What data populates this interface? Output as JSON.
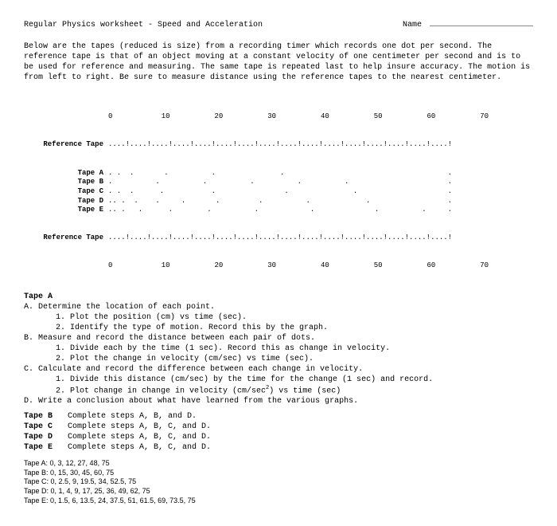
{
  "header": {
    "title": "Regular Physics worksheet - Speed and Acceleration",
    "name_label": "Name"
  },
  "intro": "Below are the tapes (reduced is size) from a recording timer which records one dot per second. The reference tape is that of an object moving at a constant velocity of one centimeter per second and is to be used for reference and measuring. The same tape is repeated last to help insure accuracy. The motion is from left to right. Be sure to measure distance using the reference tapes to the nearest centimeter.",
  "scale": [
    "0",
    "10",
    "20",
    "30",
    "40",
    "50",
    "60",
    "70"
  ],
  "tapes": {
    "ref_label": "Reference Tape",
    "ref_pattern": "....!....!....!....!....!....!....!....!....!....!....!....!....!....!....!....!",
    "rows": [
      {
        "label": "Tape A",
        "pattern": ". .  .       .          .               .                                      ."
      },
      {
        "label": "Tape B",
        "pattern": ".          .          .          .          .          .                       ."
      },
      {
        "label": "Tape C",
        "pattern": ". .  .      .           .                .               .                     ."
      },
      {
        "label": "Tape D",
        "pattern": ".. .  .    .     .       .         .          .             .                  ."
      },
      {
        "label": "Tape E",
        "pattern": ".. .   .      .        .          .            .              .          .     ."
      }
    ]
  },
  "taskHeader": "Tape A",
  "tasks": [
    {
      "letter": "A",
      "text": "Determine the location of each point.",
      "subs": [
        "1. Plot the position (cm) vs time (sec).",
        "2. Identify the type of motion. Record this by the graph."
      ]
    },
    {
      "letter": "B",
      "text": "Measure and record the distance between each pair of dots.",
      "subs": [
        "1. Divide each by the time (1 sec). Record this as change in velocity.",
        "2. Plot the change in velocity (cm/sec) vs time (sec)."
      ]
    },
    {
      "letter": "C",
      "text": "Calculate and record the difference between each change in velocity.",
      "subs": [
        "1. Divide this distance (cm/sec) by the time for the change (1 sec) and record.",
        "2. Plot change in change in velocity (cm/sec²) vs time (sec)"
      ]
    },
    {
      "letter": "D",
      "text": "Write a conclusion about what have learned from the various graphs.",
      "subs": []
    }
  ],
  "steps": [
    {
      "label": "Tape B",
      "text": "Complete steps A, B, and D."
    },
    {
      "label": "Tape C",
      "text": "Complete steps A, B, C, and D."
    },
    {
      "label": "Tape D",
      "text": "Complete steps A, B, C, and D."
    },
    {
      "label": "Tape E",
      "text": "Complete steps A, B, C, and D."
    }
  ],
  "chart_data": {
    "type": "table",
    "title": "Tape dot positions (cm)",
    "series": [
      {
        "name": "Tape A",
        "values": [
          0,
          3,
          12,
          27,
          48,
          75
        ]
      },
      {
        "name": "Tape B",
        "values": [
          0,
          15,
          30,
          45,
          60,
          75
        ]
      },
      {
        "name": "Tape C",
        "values": [
          0,
          2.5,
          9,
          19.5,
          34,
          52.5,
          75
        ]
      },
      {
        "name": "Tape D",
        "values": [
          0,
          1,
          4,
          9,
          17,
          25,
          36,
          49,
          62,
          75
        ]
      },
      {
        "name": "Tape E",
        "values": [
          0,
          1.5,
          6,
          13.5,
          24,
          37.5,
          51,
          61.5,
          69,
          73.5,
          75
        ]
      }
    ]
  }
}
